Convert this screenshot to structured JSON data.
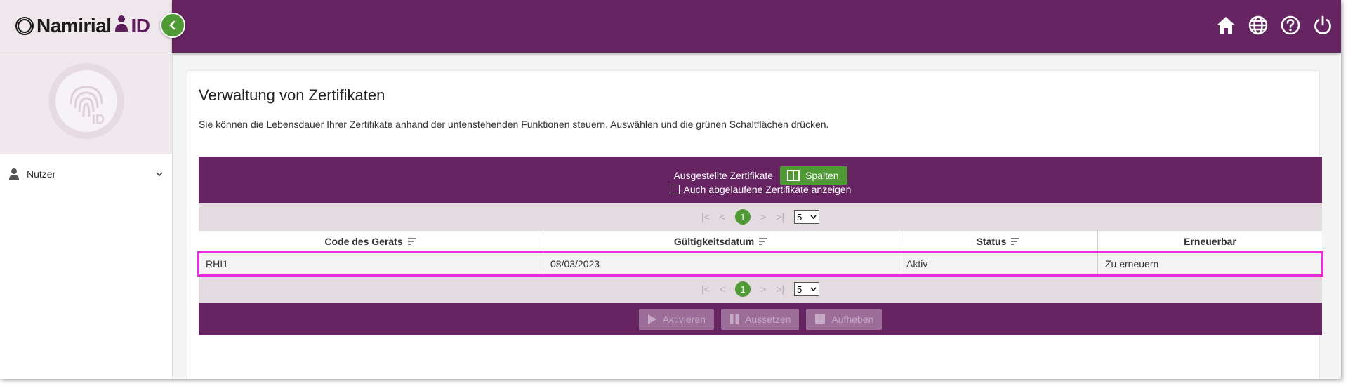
{
  "header": {
    "logo_text": "Namirial",
    "logo_id": "ID",
    "icons": [
      "home-icon",
      "globe-icon",
      "help-icon",
      "power-icon"
    ]
  },
  "sidebar": {
    "items": [
      {
        "label": "Nutzer",
        "icon": "user-icon"
      }
    ]
  },
  "main": {
    "title": "Verwaltung von Zertifikaten",
    "description": "Sie können die Lebensdauer Ihrer Zertifikate anhand der untenstehenden Funktionen steuern. Auswählen und die grünen Schaltflächen drücken."
  },
  "table": {
    "caption": "Ausgestellte Zertifikate",
    "columns_button": "Spalten",
    "show_expired_label": "Auch abgelaufene Zertifikate anzeigen",
    "show_expired_checked": false,
    "pager": {
      "current_page": "1",
      "page_size": "5"
    },
    "columns": [
      "Code des Geräts",
      "Gültigkeitsdatum",
      "Status",
      "Erneuerbar"
    ],
    "rows": [
      {
        "code": "RHI1",
        "date": "08/03/2023",
        "status": "Aktiv",
        "renewable": "Zu erneuern"
      }
    ],
    "actions": {
      "activate": "Aktivieren",
      "suspend": "Aussetzen",
      "revoke": "Aufheben"
    }
  },
  "colors": {
    "primary": "#662463",
    "accent": "#4f9a35",
    "highlight": "#ea2ce0"
  }
}
